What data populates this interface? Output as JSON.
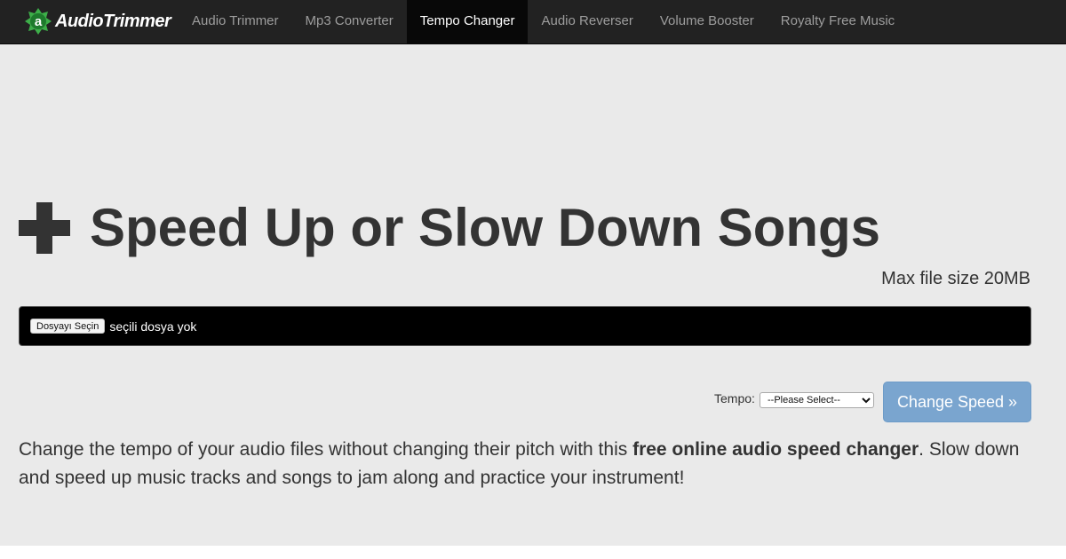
{
  "brand": {
    "name": "AudioTrimmer",
    "logo_letter": "a",
    "logo_color": "#3dae49"
  },
  "nav": {
    "items": [
      {
        "label": "Audio Trimmer"
      },
      {
        "label": "Mp3 Converter"
      },
      {
        "label": "Tempo Changer"
      },
      {
        "label": "Audio Reverser"
      },
      {
        "label": "Volume Booster"
      },
      {
        "label": "Royalty Free Music"
      }
    ],
    "active": "Tempo Changer"
  },
  "main": {
    "icon": "plus-icon",
    "title": "Speed Up or Slow Down Songs",
    "max_size": "Max file size 20MB",
    "file_button_label": "Dosyayı Seçin",
    "file_status": "seçili dosya yok",
    "tempo_label": "Tempo:",
    "tempo_selected": "--Please Select--",
    "submit_label": "Change Speed »",
    "description": {
      "part1": "Change the tempo of your audio files without changing their pitch with this ",
      "bold": "free online audio speed changer",
      "part2": ". Slow down and speed up music tracks and songs to jam along and practice your instrument!"
    }
  },
  "colors": {
    "navbar_bg": "#222222",
    "active_tab_bg": "#080808",
    "page_bg": "#eaeaea",
    "button_bg": "#7aa5cf"
  }
}
